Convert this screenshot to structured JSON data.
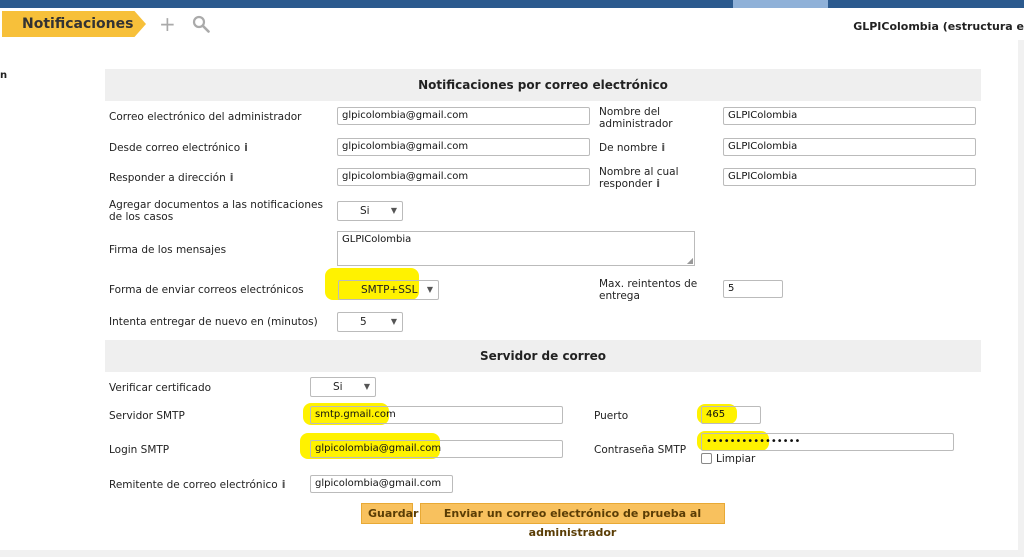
{
  "toolbar": {
    "breadcrumb": "Notificaciones",
    "entity": "GLPIColombia (estructura e"
  },
  "sidebar": {
    "fragment": "n"
  },
  "email_section": {
    "title": "Notificaciones por correo electrónico",
    "admin_email_label": "Correo electrónico del administrador",
    "admin_email_value": "glpicolombia@gmail.com",
    "admin_name_label": "Nombre del administrador",
    "admin_name_value": "GLPIColombia",
    "from_email_label": "Desde correo electrónico",
    "from_email_value": "glpicolombia@gmail.com",
    "from_name_label": "De nombre",
    "from_name_value": "GLPIColombia",
    "reply_to_label": "Responder a dirección",
    "reply_to_value": "glpicolombia@gmail.com",
    "reply_name_label": "Nombre al cual responder",
    "reply_name_value": "GLPIColombia",
    "attach_docs_label": "Agregar documentos a las notificaciones de los casos",
    "attach_docs_value": "Si",
    "signature_label": "Firma de los mensajes",
    "signature_value": "GLPIColombia",
    "send_method_label": "Forma de enviar correos electrónicos",
    "send_method_value": "SMTP+SSL",
    "max_retries_label": "Max. reintentos de entrega",
    "max_retries_value": "5",
    "retry_interval_label": "Intenta entregar de nuevo en (minutos)",
    "retry_interval_value": "5"
  },
  "smtp_section": {
    "title": "Servidor de correo",
    "verify_cert_label": "Verificar certificado",
    "verify_cert_value": "Si",
    "smtp_server_label": "Servidor SMTP",
    "smtp_server_value": "smtp.gmail.com",
    "port_label": "Puerto",
    "port_value": "465",
    "smtp_login_label": "Login SMTP",
    "smtp_login_value": "glpicolombia@gmail.com",
    "smtp_password_label": "Contraseña SMTP",
    "smtp_password_value": "••••••••••••••••",
    "clear_label": "Limpiar",
    "sender_label": "Remitente de correo electrónico",
    "sender_value": "glpicolombia@gmail.com"
  },
  "actions": {
    "save": "Guardar",
    "test": "Enviar un correo electrónico de prueba al administrador"
  },
  "colors": {
    "accent": "#f7c03a",
    "highlight": "#fff200",
    "topbar": "#2b5a8e"
  },
  "icons": {
    "add": "plus-icon",
    "search": "search-icon",
    "info": "info-icon",
    "dropdown": "chevron-down-icon"
  }
}
